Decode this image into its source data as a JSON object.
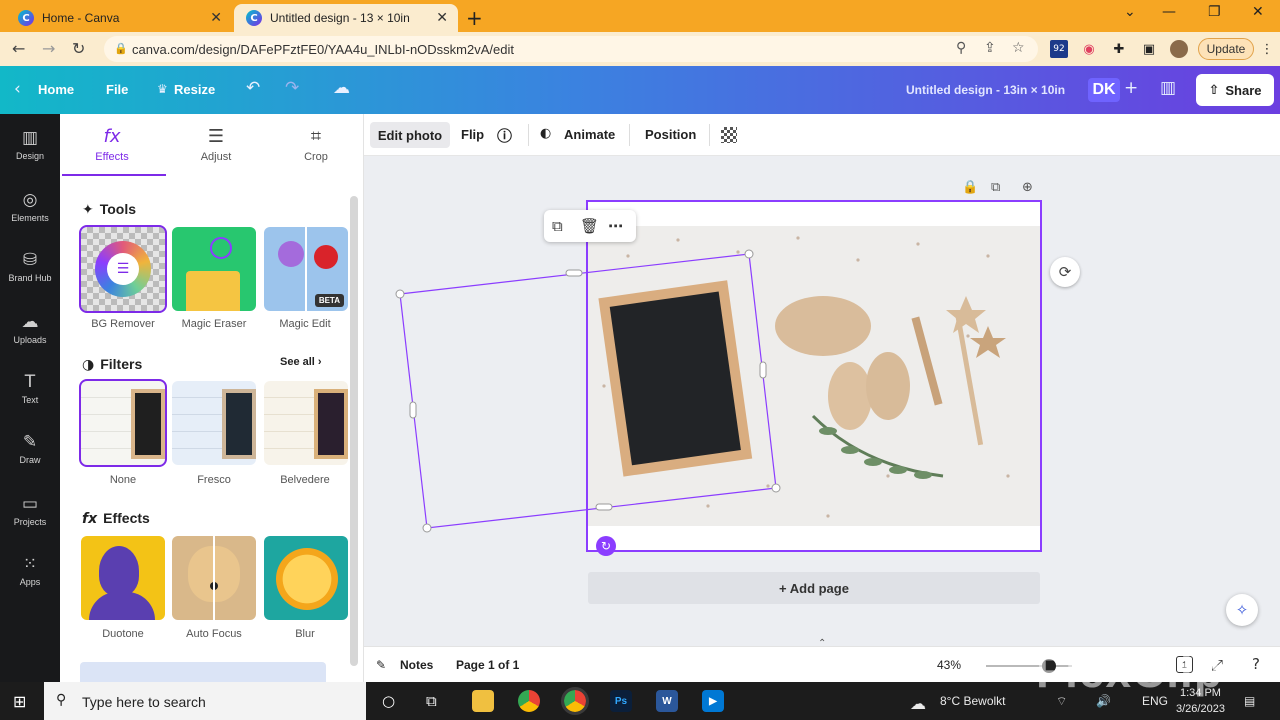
{
  "browser": {
    "tabs": [
      {
        "label": "Home - Canva",
        "active": false
      },
      {
        "label": "Untitled design - 13 × 10in",
        "active": true
      }
    ],
    "url": "canva.com/design/DAFePFztFE0/YAA4u_INLbI-nODsskm2vA/edit",
    "update_label": "Update",
    "extension_badge": "92"
  },
  "canva_header": {
    "home": "Home",
    "file": "File",
    "resize": "Resize",
    "design_title": "Untitled design - 13in × 10in",
    "avatar": "DK",
    "share": "Share"
  },
  "left_rail": [
    {
      "label": "Design",
      "icon": "design-icon"
    },
    {
      "label": "Elements",
      "icon": "elements-icon"
    },
    {
      "label": "Brand Hub",
      "icon": "brand-hub-icon"
    },
    {
      "label": "Uploads",
      "icon": "uploads-icon"
    },
    {
      "label": "Text",
      "icon": "text-icon"
    },
    {
      "label": "Draw",
      "icon": "draw-icon"
    },
    {
      "label": "Projects",
      "icon": "projects-icon"
    },
    {
      "label": "Apps",
      "icon": "apps-icon"
    }
  ],
  "panel": {
    "tabs": [
      {
        "label": "Effects",
        "icon": "fx-icon"
      },
      {
        "label": "Adjust",
        "icon": "sliders-icon"
      },
      {
        "label": "Crop",
        "icon": "crop-icon"
      }
    ],
    "tools_title": "Tools",
    "tools": [
      {
        "label": "BG Remover"
      },
      {
        "label": "Magic Eraser"
      },
      {
        "label": "Magic Edit",
        "badge": "BETA"
      }
    ],
    "filters_title": "Filters",
    "see_all": "See all",
    "filters": [
      {
        "label": "None"
      },
      {
        "label": "Fresco"
      },
      {
        "label": "Belvedere"
      }
    ],
    "effects_title": "Effects",
    "effects": [
      {
        "label": "Duotone"
      },
      {
        "label": "Auto Focus"
      },
      {
        "label": "Blur"
      }
    ]
  },
  "context_toolbar": {
    "edit_photo": "Edit photo",
    "flip": "Flip",
    "animate": "Animate",
    "position": "Position"
  },
  "canvas": {
    "add_page": "+ Add page"
  },
  "footer": {
    "notes": "Notes",
    "page_indicator": "Page 1 of 1",
    "zoom": "43%",
    "page_count_badge": "1"
  },
  "taskbar": {
    "search_placeholder": "Type here to search",
    "weather": "8°C  Bewolkt",
    "lang": "ENG",
    "time": "1:34 PM",
    "date": "3/26/2023"
  },
  "watermark": "FlexClip",
  "colors": {
    "accent": "#7d2ae8",
    "browser_frame": "#f6a623",
    "rail": "#18191b"
  }
}
